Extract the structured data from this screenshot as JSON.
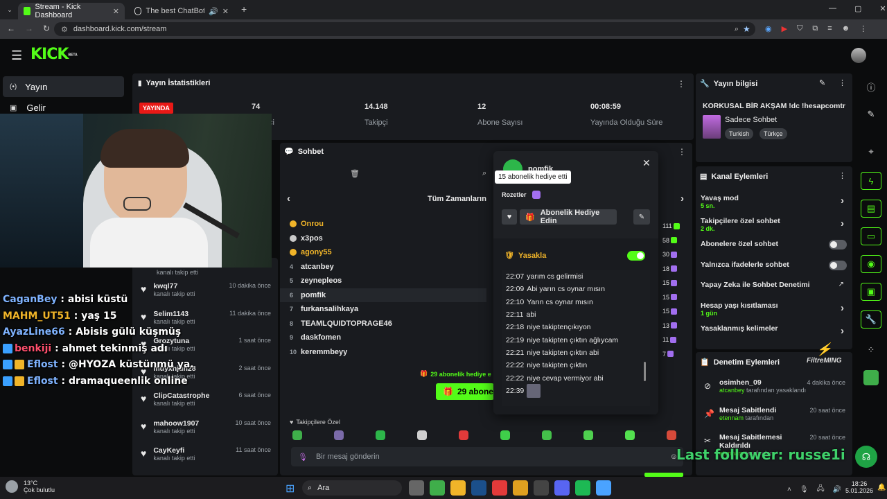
{
  "browser": {
    "tabs": [
      {
        "title": "Stream - Kick Dashboard"
      },
      {
        "title": "The best ChatBot and Widg"
      }
    ],
    "url": "dashboard.kick.com/stream"
  },
  "header": {
    "logo": "KICK",
    "logo_sup": "BETA"
  },
  "leftnav": {
    "items": [
      {
        "label": "Yayın",
        "icon": "broadcast-icon"
      },
      {
        "label": "Gelir",
        "icon": "wallet-icon"
      }
    ]
  },
  "stats": {
    "title": "Yayın İstatistikleri",
    "live_badge": "YAYINDA",
    "cells": [
      {
        "value": "74",
        "label": "İzleyici",
        "visible_label": "ci"
      },
      {
        "value": "14.148",
        "label": "Takipçi"
      },
      {
        "value": "12",
        "label": "Abone Sayısı"
      },
      {
        "value": "00:08:59",
        "label": "Yayında Olduğu Süre"
      }
    ]
  },
  "followers": [
    {
      "name": "kwql77",
      "time": "10 dakika önce",
      "sub": "kanalı takip etti"
    },
    {
      "name": "Selim1143",
      "time": "11 dakika önce",
      "sub": "kanalı takip etti"
    },
    {
      "name": "Grozytuna",
      "time": "1 saat önce",
      "sub": "kanalı takip etti"
    },
    {
      "name": "muyxhjun28",
      "time": "2 saat önce",
      "sub": "kanalı takip etti"
    },
    {
      "name": "ClipCatastrophe",
      "time": "6 saat önce",
      "sub": "kanalı takip etti"
    },
    {
      "name": "mahoow1907",
      "time": "10 saat önce",
      "sub": "kanalı takip etti"
    },
    {
      "name": "CayKeyfi",
      "time": "11 saat önce",
      "sub": "kanalı takip etti"
    }
  ],
  "follower_top_sub": "kanalı takip etti",
  "overlay_chat": [
    {
      "user": "CaganBey",
      "msg": "abisi küstü",
      "color": "#7fb3ff"
    },
    {
      "user": "MAHM_UT51",
      "msg": "yaş 15",
      "color": "#f0b429"
    },
    {
      "user": "AyazLine66",
      "msg": "Abisis gülü küşmüş",
      "color": "#7fb3ff"
    },
    {
      "user": "benkiji",
      "msg": "ahmet tekinmiş adı",
      "color": "#ff4f6d"
    },
    {
      "user": "Eflost",
      "msg": "@HYOZA küstünmü ya.",
      "color": "#7fb3ff"
    },
    {
      "user": "Eflost",
      "msg": "dramaqueenlik online",
      "color": "#7fb3ff"
    }
  ],
  "chat": {
    "title": "Sohbet",
    "leaderboard_title": "Tüm Zamanların",
    "leaderboard": [
      {
        "rank": "1",
        "name": "Onrou",
        "color": "#f0b429",
        "value": "111"
      },
      {
        "rank": "2",
        "name": "x3pos",
        "color": "#e8e8e8",
        "value": "58"
      },
      {
        "rank": "3",
        "name": "agony55",
        "color": "#f0b429",
        "value": "30"
      },
      {
        "rank": "4",
        "name": "atcanbey",
        "color": "#e8e8e8",
        "value": "18"
      },
      {
        "rank": "5",
        "name": "zeynepleos",
        "color": "#e8e8e8",
        "value": "15"
      },
      {
        "rank": "6",
        "name": "pomfik",
        "color": "#e8e8e8",
        "value": "15"
      },
      {
        "rank": "7",
        "name": "furkansalihkaya",
        "color": "#e8e8e8",
        "value": "15"
      },
      {
        "rank": "8",
        "name": "TEAMLQUIDTOPRAGE46",
        "color": "#e8e8e8",
        "value": "13"
      },
      {
        "rank": "9",
        "name": "daskfomen",
        "color": "#e8e8e8",
        "value": "11"
      },
      {
        "rank": "10",
        "name": "keremmbeyy",
        "color": "#e8e8e8",
        "value": "7"
      }
    ],
    "gift_line": "29 abonelik hediye e",
    "gift_button": "29 abone",
    "followers_only": "Takipçilere Özel",
    "input_placeholder": "Bir mesaj gönderin"
  },
  "user_popup": {
    "username": "pomfik",
    "tooltip": "15 abonelik hediye etti",
    "badges_label": "Rozetler",
    "gift_button": "Abonelik Hediye Edin",
    "ban_label": "Yasakla",
    "messages": [
      {
        "time": "22:07",
        "text": "yarım cs gelirmisi"
      },
      {
        "time": "22:09",
        "text": "Abi yarın cs oynar mısın"
      },
      {
        "time": "22:10",
        "text": "Yarın cs oynar mısın"
      },
      {
        "time": "22:11",
        "text": "abi"
      },
      {
        "time": "22:18",
        "text": "niye takiptençıkıyon"
      },
      {
        "time": "22:19",
        "text": "niye takipten çıktın ağlıycam"
      },
      {
        "time": "22:21",
        "text": "niye takipten çıktın abi"
      },
      {
        "time": "22:22",
        "text": "niye takipten çıktın"
      },
      {
        "time": "22:22",
        "text": "niye cevap vermiyor abi"
      },
      {
        "time": "22:39",
        "text": ""
      }
    ]
  },
  "stream_info": {
    "title": "Yayın bilgisi",
    "stream_title": "KORKUSAL BİR AKŞAM !dc !hesapcomtr",
    "category": "Sadece Sohbet",
    "tags": [
      "Turkish",
      "Türkçe"
    ]
  },
  "channel_actions": {
    "title": "Kanal Eylemleri",
    "items": [
      {
        "label": "Yavaş mod",
        "sub": "5 sn.",
        "control": "chevron"
      },
      {
        "label": "Takipçilere özel sohbet",
        "sub": "2 dk.",
        "control": "chevron"
      },
      {
        "label": "Abonelere özel sohbet",
        "sub": "",
        "control": "toggle"
      },
      {
        "label": "Yalnızca ifadelerle sohbet",
        "sub": "",
        "control": "toggle"
      },
      {
        "label": "Yapay Zeka ile Sohbet Denetimi",
        "sub": "",
        "control": "external"
      },
      {
        "label": "Hesap yaşı kısıtlaması",
        "sub": "1 gün",
        "control": "chevron"
      },
      {
        "label": "Yasaklanmış kelimeler",
        "sub": "",
        "control": "chevron"
      }
    ]
  },
  "moderation": {
    "title": "Denetim Eylemleri",
    "items": [
      {
        "title": "osimhen_09",
        "time": "4 dakika önce",
        "actor": "atcanbey",
        "suffix": "tarafından yasaklandı",
        "icon": "ban-icon"
      },
      {
        "title": "Mesaj Sabitlendi",
        "time": "20 saat önce",
        "actor": "etennam",
        "suffix": "tarafından",
        "icon": "pin-icon"
      },
      {
        "title": "Mesaj Sabitlemesi Kaldırıldı",
        "time": "20 saat önce",
        "actor": "etennam",
        "suffix": "tarafından",
        "icon": "unpin-icon"
      }
    ]
  },
  "overlays": {
    "last_follower": "Last follower: russe1i",
    "watermark": "FiltreMING"
  },
  "taskbar": {
    "weather_temp": "13°C",
    "weather_desc": "Çok bulutlu",
    "search": "Ara",
    "time": "18:26",
    "date": "5.01.2026"
  }
}
